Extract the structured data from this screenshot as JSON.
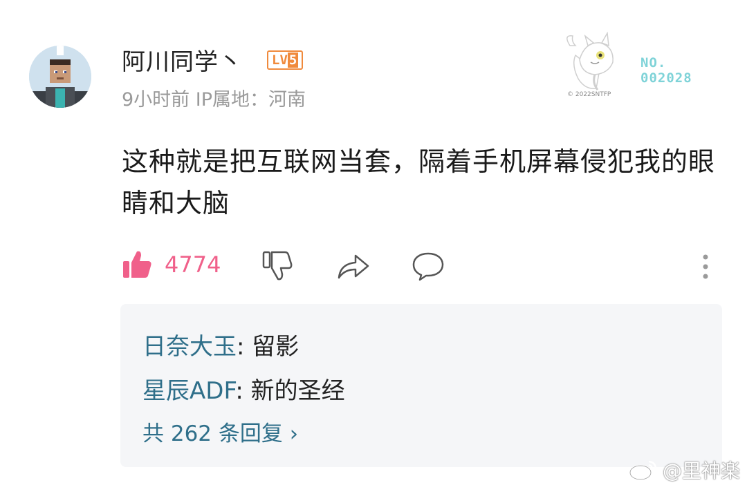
{
  "comment": {
    "username": "阿川同学丶",
    "level_badge": {
      "prefix": "LV",
      "number": "5"
    },
    "time": "9小时前",
    "ip_location": "IP属地：河南",
    "content": "这种就是把互联网当套，隔着手机屏幕侵犯我的眼睛和大脑",
    "like_count": "4774",
    "decoration": {
      "no_label": "NO.",
      "number": "002028",
      "copyright": "© 2022SNTFP"
    }
  },
  "replies": {
    "items": [
      {
        "name": "日奈大玉",
        "separator": ": ",
        "text": "留影"
      },
      {
        "name": "星辰ADF",
        "separator": ": ",
        "text": "新的圣经"
      }
    ],
    "more_label": "共 262 条回复 ›"
  },
  "watermark": {
    "text": "@里神楽"
  },
  "colors": {
    "accent": "#2f6f8a",
    "like": "#f0608a",
    "level": "#f08a3c",
    "meta": "#9a9a9a"
  },
  "icons": [
    "like-icon",
    "dislike-icon",
    "share-icon",
    "comment-icon",
    "more-icon",
    "weibo-icon"
  ]
}
